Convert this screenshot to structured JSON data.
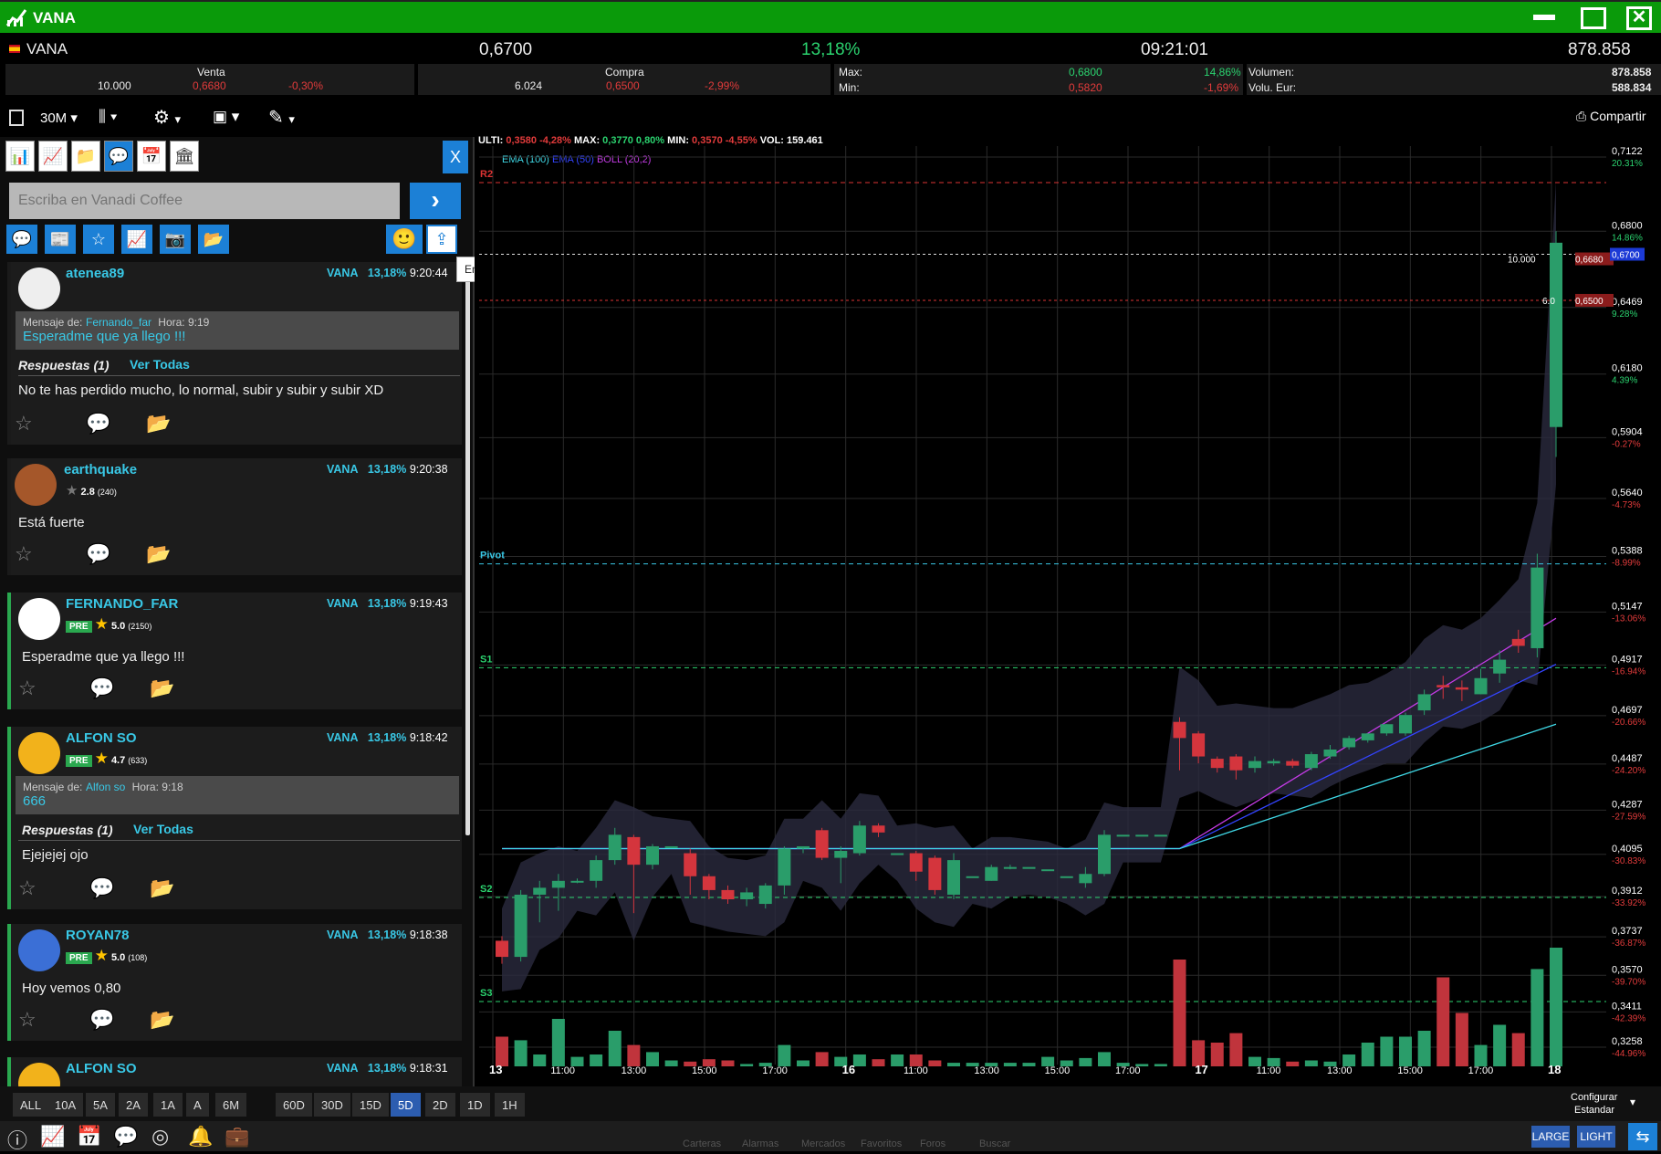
{
  "window": {
    "title": "VANA"
  },
  "quote": {
    "symbol": "VANA",
    "price": "0,6700",
    "change_pct": "13,18%",
    "time": "09:21:01",
    "volume": "878.858"
  },
  "sell": {
    "label": "Venta",
    "qty": "10.000",
    "price": "0,6680",
    "pct": "-0,30%"
  },
  "buy": {
    "label": "Compra",
    "qty": "6.024",
    "price": "0,6500",
    "pct": "-2,99%"
  },
  "maxmin": {
    "max_label": "Max:",
    "max_val": "0,6800",
    "max_pct": "14,86%",
    "min_label": "Min:",
    "min_val": "0,5820",
    "min_pct": "-1,69%"
  },
  "volumes": {
    "vol_label": "Volumen:",
    "vol_val": "878.858",
    "volu_label": "Volu. Eur:",
    "volu_val": "588.834"
  },
  "toolbar": {
    "interval": "30M",
    "share": "Compartir"
  },
  "chat": {
    "placeholder": "Escriba en Vanadi Coffee",
    "close": "X",
    "tooltip": "Enviar Foto"
  },
  "posts": [
    {
      "user": "atenea89",
      "sym": "VANA",
      "pct": "13,18%",
      "time": "9:20:44",
      "quote_from_label": "Mensaje de:",
      "quote_from": "Fernando_far",
      "quote_time": "Hora: 9:19",
      "quote_text": "Esperadme que ya llego !!!",
      "replies": "Respuestas (1)",
      "see_all": "Ver Todas",
      "text": "No te has perdido mucho, lo normal, subir y subir y subir XD"
    },
    {
      "user": "earthquake",
      "sym": "VANA",
      "pct": "13,18%",
      "time": "9:20:38",
      "rating": "2.8",
      "rating_count": "(240)",
      "text": "Está fuerte"
    },
    {
      "user": "FERNANDO_FAR",
      "sym": "VANA",
      "pct": "13,18%",
      "time": "9:19:43",
      "pre": "PRE",
      "rating": "5.0",
      "rating_count": "(2150)",
      "text": "Esperadme que ya llego !!!"
    },
    {
      "user": "ALFON SO",
      "sym": "VANA",
      "pct": "13,18%",
      "time": "9:18:42",
      "pre": "PRE",
      "rating": "4.7",
      "rating_count": "(633)",
      "quote_from_label": "Mensaje de:",
      "quote_from": "Alfon so",
      "quote_time": "Hora: 9:18",
      "quote_text": "666",
      "replies": "Respuestas (1)",
      "see_all": "Ver Todas",
      "text": "Ejejejej ojo"
    },
    {
      "user": "ROYAN78",
      "sym": "VANA",
      "pct": "13,18%",
      "time": "9:18:38",
      "pre": "PRE",
      "rating": "5.0",
      "rating_count": "(108)",
      "text": "Hoy vemos 0,80"
    },
    {
      "user": "ALFON SO",
      "sym": "VANA",
      "pct": "13,18%",
      "time": "9:18:31"
    }
  ],
  "chart_header": {
    "ulti_label": "ULTI:",
    "ulti": "0,3580",
    "ulti_pct": "-4,28%",
    "max_label": "MAX:",
    "max": "0,3770",
    "max_pct": "0,80%",
    "min_label": "MIN:",
    "min": "0,3570",
    "min_pct": "-4,55%",
    "vol_label": "VOL:",
    "vol": "159.461"
  },
  "indicators": {
    "ema100": "EMA (100)",
    "ema50": "EMA (50)",
    "boll": "BOLL (20,2)"
  },
  "levels": {
    "r2": "R2",
    "pivot": "Pivot",
    "s1": "S1",
    "s2": "S2",
    "s3": "S3"
  },
  "order_labels": {
    "sell_qty": "10.000",
    "sell_price": "0,6680",
    "buy_qty": "6.0",
    "buy_price": "0,6500",
    "last": "0,6700"
  },
  "chart_data": {
    "type": "candlestick",
    "y_axis": [
      {
        "v": "0,7122",
        "p": "20.31%"
      },
      {
        "v": "0,6800",
        "p": "14.86%"
      },
      {
        "v": "0,6469",
        "p": "9.28%"
      },
      {
        "v": "0,6180",
        "p": "4.39%"
      },
      {
        "v": "0,5904",
        "p": "-0.27%"
      },
      {
        "v": "0,5640",
        "p": "-4.73%"
      },
      {
        "v": "0,5388",
        "p": "-8.99%"
      },
      {
        "v": "0,5147",
        "p": "-13.06%"
      },
      {
        "v": "0,4917",
        "p": "-16.94%"
      },
      {
        "v": "0,4697",
        "p": "-20.66%"
      },
      {
        "v": "0,4487",
        "p": "-24.20%"
      },
      {
        "v": "0,4287",
        "p": "-27.59%"
      },
      {
        "v": "0,4095",
        "p": "-30.83%"
      },
      {
        "v": "0,3912",
        "p": "-33.92%"
      },
      {
        "v": "0,3737",
        "p": "-36.87%"
      },
      {
        "v": "0,3570",
        "p": "-39.70%"
      },
      {
        "v": "0,3411",
        "p": "-42.39%"
      },
      {
        "v": "0,3258",
        "p": "-44.96%"
      }
    ],
    "x_labels": [
      "13",
      "11:00",
      "13:00",
      "15:00",
      "17:00",
      "16",
      "11:00",
      "13:00",
      "15:00",
      "17:00",
      "17",
      "11:00",
      "13:00",
      "15:00",
      "17:00",
      "18"
    ],
    "candles": [
      [
        0.372,
        0.365,
        0.374,
        0.362
      ],
      [
        0.365,
        0.392,
        0.394,
        0.363
      ],
      [
        0.392,
        0.395,
        0.398,
        0.38
      ],
      [
        0.395,
        0.398,
        0.401,
        0.385
      ],
      [
        0.398,
        0.398,
        0.399,
        0.397
      ],
      [
        0.398,
        0.407,
        0.409,
        0.395
      ],
      [
        0.407,
        0.418,
        0.421,
        0.405
      ],
      [
        0.417,
        0.405,
        0.418,
        0.384
      ],
      [
        0.405,
        0.413,
        0.414,
        0.403
      ],
      [
        0.413,
        0.413,
        0.413,
        0.413
      ],
      [
        0.41,
        0.4,
        0.412,
        0.392
      ],
      [
        0.4,
        0.394,
        0.401,
        0.39
      ],
      [
        0.394,
        0.39,
        0.396,
        0.388
      ],
      [
        0.39,
        0.393,
        0.395,
        0.387
      ],
      [
        0.388,
        0.396,
        0.397,
        0.386
      ],
      [
        0.396,
        0.412,
        0.413,
        0.392
      ],
      [
        0.412,
        0.413,
        0.413,
        0.41
      ],
      [
        0.42,
        0.408,
        0.421,
        0.407
      ],
      [
        0.408,
        0.411,
        0.413,
        0.397
      ],
      [
        0.41,
        0.422,
        0.424,
        0.409
      ],
      [
        0.422,
        0.419,
        0.423,
        0.417
      ],
      [
        0.41,
        0.41,
        0.41,
        0.41
      ],
      [
        0.41,
        0.402,
        0.411,
        0.398
      ],
      [
        0.408,
        0.394,
        0.409,
        0.392
      ],
      [
        0.392,
        0.407,
        0.41,
        0.39
      ],
      [
        0.4,
        0.4,
        0.4,
        0.4
      ],
      [
        0.398,
        0.404,
        0.405,
        0.398
      ],
      [
        0.404,
        0.404,
        0.405,
        0.403
      ],
      [
        0.404,
        0.404,
        0.404,
        0.404
      ],
      [
        0.403,
        0.403,
        0.403,
        0.403
      ],
      [
        0.4,
        0.4,
        0.4,
        0.4
      ],
      [
        0.397,
        0.401,
        0.404,
        0.395
      ],
      [
        0.401,
        0.418,
        0.42,
        0.4
      ],
      [
        0.418,
        0.418,
        0.418,
        0.418
      ],
      [
        0.418,
        0.418,
        0.418,
        0.418
      ],
      [
        0.418,
        0.418,
        0.418,
        0.418
      ],
      [
        0.467,
        0.46,
        0.469,
        0.446
      ],
      [
        0.462,
        0.452,
        0.463,
        0.449
      ],
      [
        0.451,
        0.447,
        0.452,
        0.445
      ],
      [
        0.452,
        0.446,
        0.453,
        0.442
      ],
      [
        0.447,
        0.45,
        0.452,
        0.445
      ],
      [
        0.449,
        0.45,
        0.451,
        0.448
      ],
      [
        0.45,
        0.448,
        0.451,
        0.447
      ],
      [
        0.447,
        0.453,
        0.454,
        0.446
      ],
      [
        0.452,
        0.455,
        0.457,
        0.451
      ],
      [
        0.456,
        0.46,
        0.461,
        0.455
      ],
      [
        0.459,
        0.462,
        0.462,
        0.458
      ],
      [
        0.462,
        0.466,
        0.466,
        0.461
      ],
      [
        0.462,
        0.47,
        0.471,
        0.461
      ],
      [
        0.472,
        0.479,
        0.481,
        0.47
      ],
      [
        0.483,
        0.482,
        0.487,
        0.477
      ],
      [
        0.482,
        0.481,
        0.485,
        0.476
      ],
      [
        0.479,
        0.486,
        0.49,
        0.479
      ],
      [
        0.488,
        0.494,
        0.498,
        0.484
      ],
      [
        0.503,
        0.5,
        0.507,
        0.497
      ],
      [
        0.499,
        0.534,
        0.54,
        0.495
      ],
      [
        0.595,
        0.675,
        0.68,
        0.582
      ]
    ],
    "volume_fraction": [
      0.25,
      0.22,
      0.1,
      0.4,
      0.08,
      0.1,
      0.3,
      0.18,
      0.12,
      0.05,
      0.04,
      0.06,
      0.05,
      0.02,
      0.03,
      0.18,
      0.05,
      0.12,
      0.08,
      0.1,
      0.06,
      0.1,
      0.1,
      0.05,
      0.03,
      0.03,
      0.03,
      0.03,
      0.03,
      0.08,
      0.05,
      0.07,
      0.12,
      0.03,
      0.02,
      0.02,
      0.9,
      0.22,
      0.2,
      0.28,
      0.08,
      0.07,
      0.04,
      0.05,
      0.04,
      0.1,
      0.2,
      0.25,
      0.25,
      0.3,
      0.75,
      0.45,
      0.18,
      0.35,
      0.28,
      0.82,
      1.0
    ]
  },
  "timeframes_left": [
    "ALL",
    "10A",
    "5A",
    "2A",
    "1A",
    "A",
    "6M"
  ],
  "timeframes_right": [
    "60D",
    "30D",
    "15D",
    "5D",
    "2D",
    "1D",
    "1H"
  ],
  "config": {
    "label": "Configurar",
    "value": "Estandar"
  },
  "taskbar": {
    "items": [
      "Carteras",
      "Alarmas",
      "Mercados",
      "Favoritos",
      "Foros",
      "Buscar"
    ],
    "large": "LARGE",
    "light": "LIGHT"
  }
}
